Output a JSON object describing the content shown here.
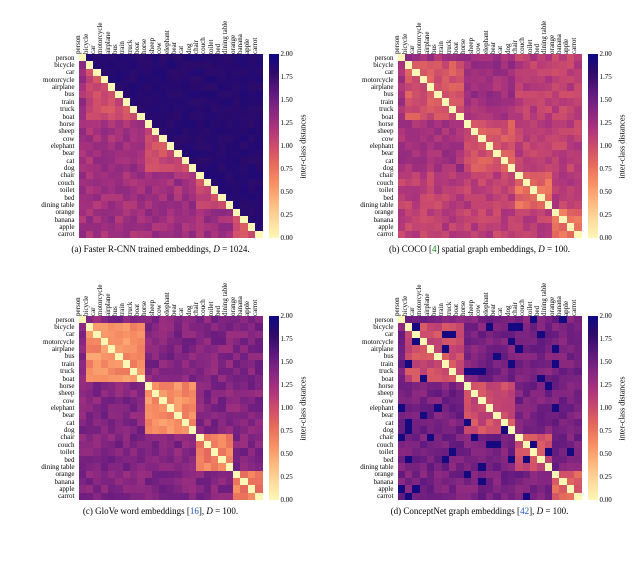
{
  "labels": [
    "person",
    "bicycle",
    "car",
    "motorcycle",
    "airplane",
    "bus",
    "train",
    "truck",
    "boat",
    "horse",
    "sheep",
    "cow",
    "elephant",
    "bear",
    "cat",
    "dog",
    "chair",
    "couch",
    "toilet",
    "bed",
    "dining table",
    "orange",
    "banana",
    "apple",
    "carrot"
  ],
  "colorbar": {
    "ticks": [
      "0.00",
      "0.25",
      "0.50",
      "0.75",
      "1.00",
      "1.25",
      "1.50",
      "1.75",
      "2.00"
    ],
    "label": "inter-class distances"
  },
  "chart_data": [
    {
      "type": "heatmap",
      "x": "labels",
      "y": "labels",
      "zmin": 0.0,
      "zmax": 2.0,
      "title": "",
      "data_is_estimated": true,
      "note": "Upper triangle ~1.8–2.0, lower triangle ~0.9–1.4, diagonal 0; animals (rows 10–16) mutually ~0.8–1.1.",
      "values": "approx_a"
    },
    {
      "type": "heatmap",
      "x": "labels",
      "y": "labels",
      "zmin": 0.0,
      "zmax": 2.0,
      "data_is_estimated": true,
      "note": "Overall ~0.9–1.4 both triangles; furniture rows (17–21) and food rows (22–25) brighter (~0.8–1.0); diagonal 0.",
      "values": "approx_b"
    },
    {
      "type": "heatmap",
      "x": "labels",
      "y": "labels",
      "zmin": 0.0,
      "zmax": 2.0,
      "data_is_estimated": true,
      "note": "Vehicle block rows 2–9 light (~0.5–0.9); animal block rows 10–16 light (~0.6–1.0); cross-group ~1.2–1.7; diagonal 0.",
      "values": "approx_c"
    },
    {
      "type": "heatmap",
      "x": "labels",
      "y": "labels",
      "zmin": 0.0,
      "zmax": 2.0,
      "data_is_estimated": true,
      "note": "Mostly ~1.2–1.6; food rows 22–25 mutually ~0.7–1.0; a few near-2.0 cells scattered; diagonal 0.",
      "values": "approx_d"
    }
  ],
  "captions": {
    "a": {
      "prefix": "(a) Faster R-CNN trained embeddings, ",
      "D": "D",
      "val": " = 1024."
    },
    "b": {
      "prefix": "(b) COCO [",
      "cite": "4",
      "mid": "] spatial graph embeddings, ",
      "D": "D",
      "val": " = 100."
    },
    "c": {
      "prefix": "(c) GloVe word embeddings [",
      "cite": "16",
      "mid": "], ",
      "D": "D",
      "val": " = 100."
    },
    "d": {
      "prefix": "(d) ConceptNet graph embeddings [",
      "cite": "42",
      "mid": "], ",
      "D": "D",
      "val": " = 100."
    }
  }
}
